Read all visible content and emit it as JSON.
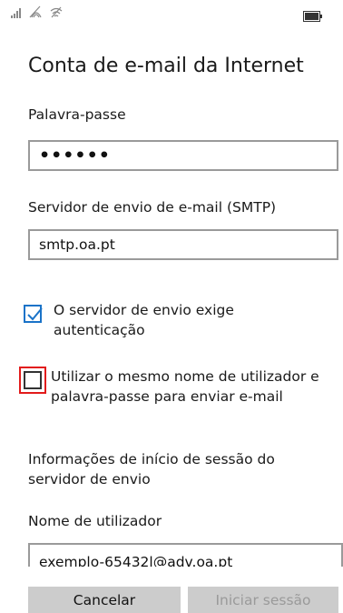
{
  "title": "Conta de e-mail da Internet",
  "password": {
    "label": "Palavra-passe",
    "value": "••••••"
  },
  "smtp": {
    "label": "Servidor de envio de e-mail (SMTP)",
    "value": "smtp.oa.pt"
  },
  "checkboxes": [
    {
      "text": "O servidor de envio exige autenticação",
      "checked": true
    },
    {
      "text": "Utilizar o mesmo nome de utilizador e palavra-passe para enviar e-mail",
      "checked": false
    }
  ],
  "outgoing_info": "Informações de início de sessão do servidor de envio",
  "username": {
    "label": "Nome de utilizador",
    "value": "exemplo-65432l@adv.oa.pt"
  },
  "buttons": {
    "cancel": "Cancelar",
    "signin": "Iniciar sessão"
  },
  "icons": {
    "signal": "signal-bars-icon",
    "wifi": "wifi-icon",
    "battery": "battery-icon"
  },
  "colors": {
    "accent": "#1a73c8",
    "highlight": "#e21b1b",
    "button_bg": "#cccccc"
  }
}
